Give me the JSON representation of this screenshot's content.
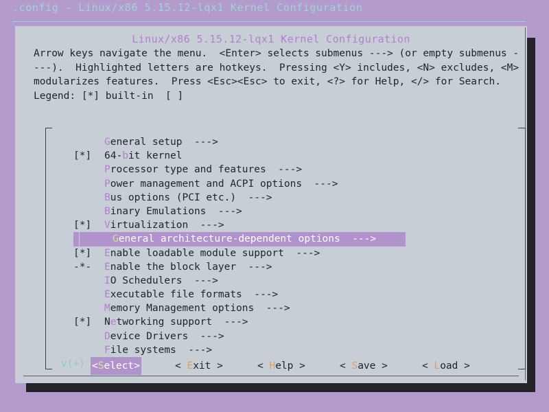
{
  "terminal": {
    "title": ".config - Linux/x86 5.15.12-lqx1 Kernel Configuration"
  },
  "dialog": {
    "title": "Linux/x86 5.15.12-lqx1 Kernel Configuration",
    "help_text": "Arrow keys navigate the menu.  <Enter> selects submenus ---> (or empty submenus ----).  Highlighted letters are hotkeys.  Pressing <Y> includes, <N> excludes, <M> modularizes features.  Press <Esc><Esc> to exit, <?> for Help, </> for Search.  Legend: [*] built-in  [ ]"
  },
  "menu": {
    "items": [
      {
        "flag": "",
        "pre": "",
        "hot": "G",
        "post": "eneral setup  --->",
        "selected": false
      },
      {
        "flag": "[*]",
        "pre": "64-",
        "hot": "b",
        "post": "it kernel",
        "selected": false
      },
      {
        "flag": "",
        "pre": "",
        "hot": "P",
        "post": "rocessor type and features  --->",
        "selected": false
      },
      {
        "flag": "",
        "pre": "",
        "hot": "P",
        "post": "ower management and ACPI options  --->",
        "selected": false
      },
      {
        "flag": "",
        "pre": "",
        "hot": "B",
        "post": "us options (PCI etc.)  --->",
        "selected": false
      },
      {
        "flag": "",
        "pre": "",
        "hot": "B",
        "post": "inary Emulations  --->",
        "selected": false
      },
      {
        "flag": "[*]",
        "pre": "",
        "hot": "V",
        "post": "irtualization  --->",
        "selected": false
      },
      {
        "flag": "",
        "pre": "",
        "hot": "G",
        "post": "eneral architecture-dependent options  --->",
        "selected": true
      },
      {
        "flag": "[*]",
        "pre": "",
        "hot": "E",
        "post": "nable loadable module support  --->",
        "selected": false
      },
      {
        "flag": "-*-",
        "pre": "",
        "hot": "E",
        "post": "nable the block layer  --->",
        "selected": false
      },
      {
        "flag": "",
        "pre": "",
        "hot": "I",
        "post": "O Schedulers  --->",
        "selected": false
      },
      {
        "flag": "",
        "pre": "",
        "hot": "E",
        "post": "xecutable file formats  --->",
        "selected": false
      },
      {
        "flag": "",
        "pre": "",
        "hot": "M",
        "post": "emory Management options  --->",
        "selected": false
      },
      {
        "flag": "[*]",
        "pre": "N",
        "hot": "e",
        "post": "tworking support  --->",
        "selected": false
      },
      {
        "flag": "",
        "pre": "",
        "hot": "D",
        "post": "evice Drivers  --->",
        "selected": false
      },
      {
        "flag": "",
        "pre": "",
        "hot": "F",
        "post": "ile systems  --->",
        "selected": false
      }
    ],
    "scroll_more": "v(+)"
  },
  "buttons": [
    {
      "pre": "<",
      "hot": "S",
      "post": "elect>",
      "active": true
    },
    {
      "pre": "< ",
      "hot": "E",
      "post": "xit >",
      "active": false
    },
    {
      "pre": "< ",
      "hot": "H",
      "post": "elp >",
      "active": false
    },
    {
      "pre": "< ",
      "hot": "S",
      "post": "ave >",
      "active": false
    },
    {
      "pre": "< ",
      "hot": "L",
      "post": "oad >",
      "active": false
    }
  ],
  "colors": {
    "desktop": "#b39ccd",
    "dialog_bg": "#c8ced6",
    "hotkey": "#b37fce",
    "highlight_bg": "#b093cd",
    "scroll_indicator": "#8fd0a8",
    "term_title": "#9fd4d6",
    "button_hotkey": "#e0a060"
  }
}
